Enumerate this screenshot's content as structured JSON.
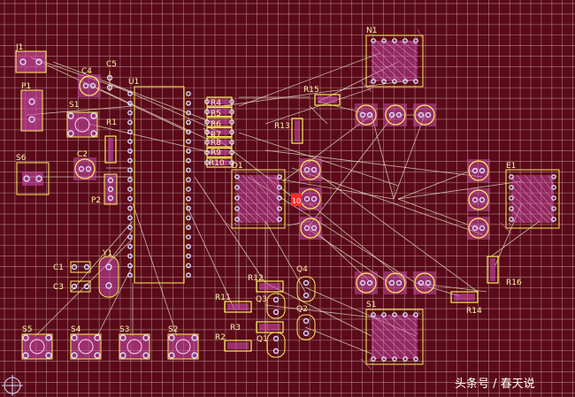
{
  "board": {
    "background": "#5a0a18",
    "grid_color": "#b98f96",
    "outline_color": "#e6d65a",
    "ratsnest_color": "#e8e2c8",
    "pad_color": "#d9d9ff",
    "pad_fill": "#d24fb3",
    "silk_color": "#ffef5a",
    "error_color": "#ff2a2a"
  },
  "components": {
    "J1": "J1",
    "P1": "P1",
    "C4": "C4",
    "C5": "C5",
    "U1": "U1",
    "S1a": "S1",
    "R1": "R1",
    "C2": "C2",
    "P2": "P2",
    "S6": "S6",
    "Y1": "Y1",
    "C1": "C1",
    "C3": "C3",
    "R4": "R4",
    "R5": "R5",
    "R6": "R6",
    "R7": "R7",
    "R8": "R8",
    "R9": "R9",
    "R10": "R10",
    "D1": "D1",
    "R13": "R13",
    "R15": "R15",
    "N1": "N1",
    "E1": "E1",
    "R12": "R12",
    "R11": "R11",
    "Q3": "Q3",
    "Q4": "Q4",
    "Q2": "Q2",
    "R3": "R3",
    "Q1": "Q1",
    "R2": "R2",
    "S5": "S5",
    "S4": "S4",
    "S3": "S3",
    "S2": "S2",
    "S1b": "S1",
    "R14": "R14",
    "R16": "R16",
    "led": "10"
  },
  "watermark": "头条号 / 春天说"
}
